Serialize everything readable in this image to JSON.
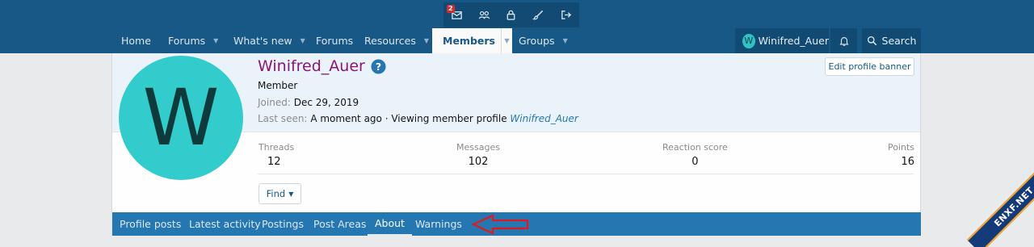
{
  "topbar": {
    "inbox_badge": "2",
    "icons": [
      "inbox-icon",
      "members-icon",
      "lock-icon",
      "brush-icon",
      "logout-icon"
    ]
  },
  "nav": {
    "home": "Home",
    "forums": "Forums",
    "whats_new": "What's new",
    "forums2": "Forums",
    "resources": "Resources",
    "members": "Members",
    "groups": "Groups",
    "account": "Winifred_Auer",
    "account_initial": "W",
    "search": "Search"
  },
  "profile": {
    "avatar_letter": "W",
    "username": "Winifred_Auer",
    "role": "Member",
    "joined_label": "Joined:",
    "joined_value": "Dec 29, 2019",
    "last_seen_label": "Last seen:",
    "last_seen_value": "A moment ago · Viewing member profile",
    "last_seen_link": "Winifred_Auer",
    "edit_banner": "Edit profile banner"
  },
  "stats": {
    "threads_label": "Threads",
    "threads_value": "12",
    "messages_label": "Messages",
    "messages_value": "102",
    "reaction_label": "Reaction score",
    "reaction_value": "0",
    "points_label": "Points",
    "points_value": "16"
  },
  "find_button": "Find",
  "tabs": {
    "profile_posts": "Profile posts",
    "latest_activity": "Latest activity",
    "postings": "Postings",
    "post_areas": "Post Areas",
    "about": "About",
    "warnings": "Warnings"
  },
  "watermark": "ENXF.NET",
  "colors": {
    "header": "#185886",
    "accent": "#2577b1",
    "username": "#8a1578",
    "avatar": "#33cccc",
    "annotation_arrow": "#e0191e"
  }
}
